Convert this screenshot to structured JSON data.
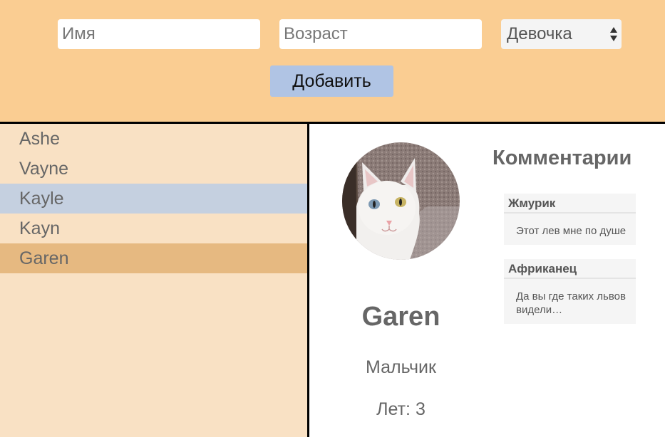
{
  "form": {
    "name_placeholder": "Имя",
    "age_placeholder": "Возраст",
    "gender_selected": "Девочка",
    "add_label": "Добавить"
  },
  "list": {
    "items": [
      "Ashe",
      "Vayne",
      "Kayle",
      "Kayn",
      "Garen"
    ],
    "hovered": "Kayle",
    "selected": "Garen"
  },
  "detail": {
    "name": "Garen",
    "gender": "Мальчик",
    "age": "Лет: 3",
    "comments_title": "Комментарии",
    "comments": [
      {
        "author": "Жмурик",
        "text": "Этот лев мне по душе"
      },
      {
        "author": "Африканец",
        "text": "Да вы где таких львов видели…"
      }
    ]
  },
  "colors": {
    "header_bg": "#facd92",
    "list_bg": "#f9e1c4",
    "hover_bg": "#c5d0e0",
    "selected_bg": "#e6b981",
    "button_bg": "#b0c4e4"
  }
}
